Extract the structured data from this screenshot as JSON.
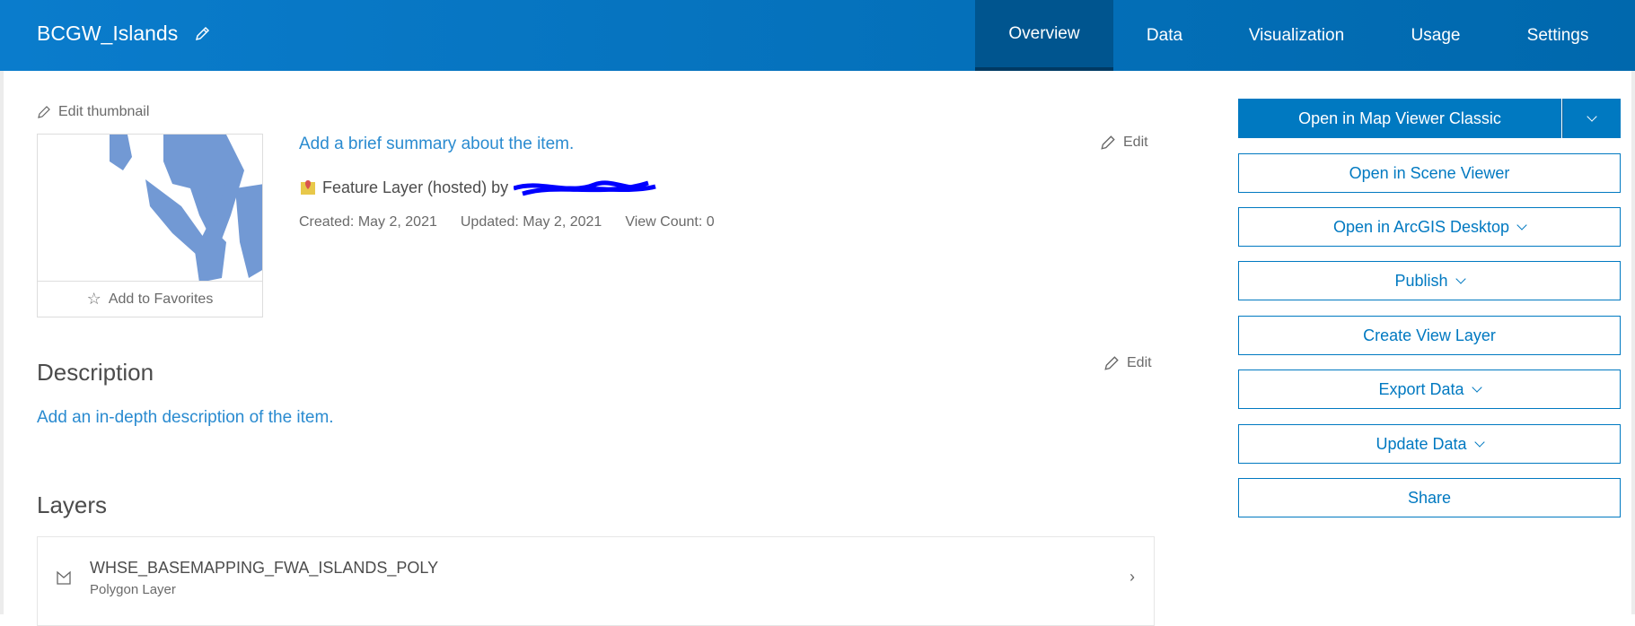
{
  "header": {
    "title": "BCGW_Islands",
    "tabs": [
      "Overview",
      "Data",
      "Visualization",
      "Usage",
      "Settings"
    ],
    "active_tab": "Overview"
  },
  "thumbnail": {
    "edit_label": "Edit thumbnail",
    "favorites_label": "Add to Favorites"
  },
  "summary": {
    "placeholder": "Add a brief summary about the item.",
    "edit_label": "Edit",
    "type_text": "Feature Layer (hosted) by",
    "created": "Created: May 2, 2021",
    "updated": "Updated: May 2, 2021",
    "view_count": "View Count: 0"
  },
  "description": {
    "heading": "Description",
    "edit_label": "Edit",
    "placeholder": "Add an in-depth description of the item."
  },
  "layers": {
    "heading": "Layers",
    "items": [
      {
        "name": "WHSE_BASEMAPPING_FWA_ISLANDS_POLY",
        "type": "Polygon Layer"
      }
    ]
  },
  "actions": [
    "Open in Map Viewer Classic",
    "Open in Scene Viewer",
    "Open in ArcGIS Desktop",
    "Publish",
    "Create View Layer",
    "Export Data",
    "Update Data",
    "Share"
  ],
  "colors": {
    "accent": "#0079c1",
    "header": "#0a7ccc",
    "link": "#2a8bd0",
    "redaction": "#0000ff"
  }
}
